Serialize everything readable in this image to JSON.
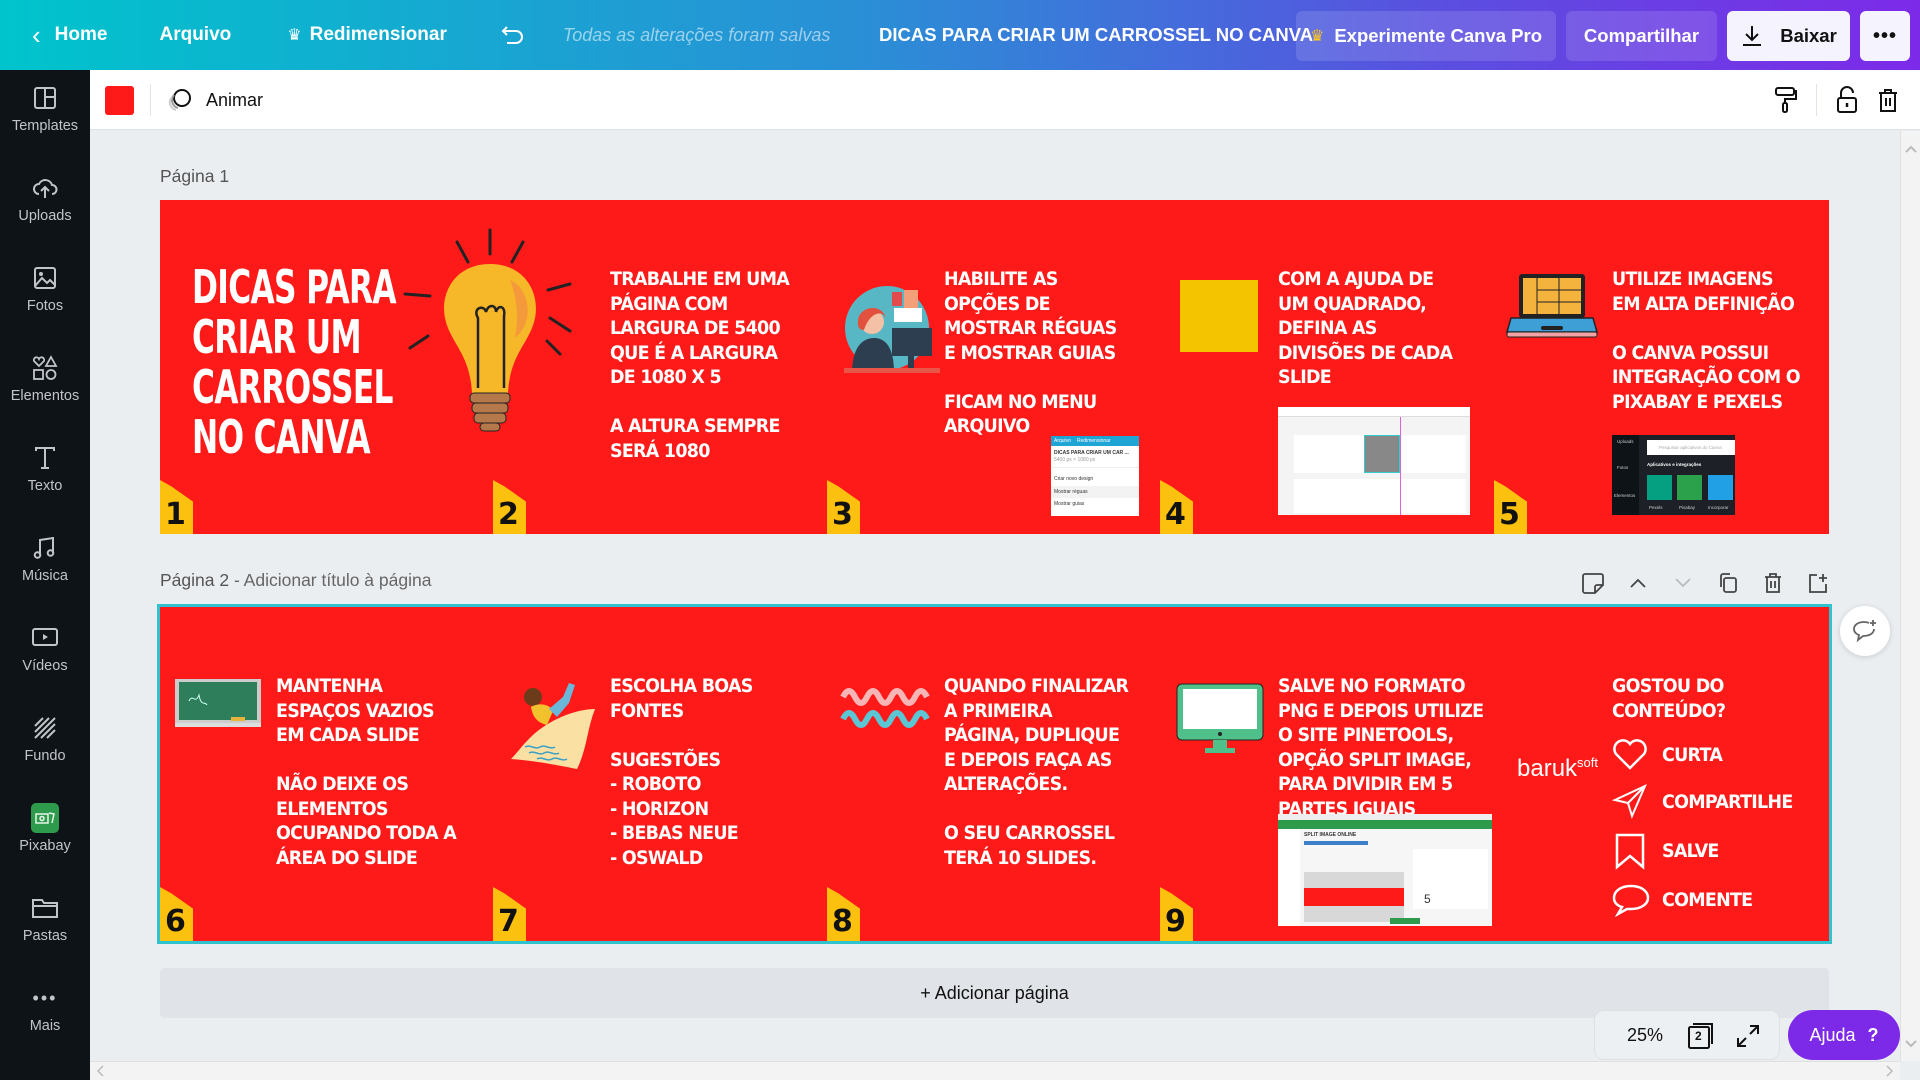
{
  "topbar": {
    "home_label": "Home",
    "file_label": "Arquivo",
    "resize_label": "Redimensionar",
    "saved_status": "Todas as alterações foram salvas",
    "design_title": "DICAS PARA CRIAR UM CARROSSEL NO CANVA",
    "pro_label": "Experimente Canva Pro",
    "share_label": "Compartilhar",
    "download_label": "Baixar",
    "more_label": "•••"
  },
  "sidebar": {
    "items": [
      {
        "label": "Templates",
        "icon": "templates-icon"
      },
      {
        "label": "Uploads",
        "icon": "upload-cloud-icon"
      },
      {
        "label": "Fotos",
        "icon": "photo-icon"
      },
      {
        "label": "Elementos",
        "icon": "elements-icon"
      },
      {
        "label": "Texto",
        "icon": "text-icon"
      },
      {
        "label": "Música",
        "icon": "music-icon"
      },
      {
        "label": "Vídeos",
        "icon": "video-icon"
      },
      {
        "label": "Fundo",
        "icon": "background-icon"
      },
      {
        "label": "Pixabay",
        "icon": "pixabay-icon"
      },
      {
        "label": "Pastas",
        "icon": "folder-icon"
      },
      {
        "label": "Mais",
        "icon": "more-icon"
      }
    ]
  },
  "toolbar": {
    "color": "#ff1a1a",
    "animate_label": "Animar"
  },
  "pages": [
    {
      "label": "Página 1",
      "title_hint": "",
      "title": "DICAS PARA\nCRIAR UM\nCARROSSEL\nNO CANVA",
      "slides": [
        {
          "number": "1"
        },
        {
          "number": "2",
          "text": "TRABALHE EM UMA\nPÁGINA COM\nLARGURA DE 5400\nQUE É A LARGURA\nDE 1080 X 5\n\nA ALTURA SEMPRE\nSERÁ 1080"
        },
        {
          "number": "3",
          "text": "HABILITE AS\nOPÇÕES DE\nMOSTRAR RÉGUAS\nE MOSTRAR GUIAS\n\nFICAM NO MENU\nARQUIVO"
        },
        {
          "number": "4",
          "text": "COM A AJUDA DE\nUM QUADRADO,\nDEFINA AS\nDIVISÕES DE CADA\nSLIDE"
        },
        {
          "number": "5",
          "text": "UTILIZE IMAGENS\nEM ALTA DEFINIÇÃO\n\nO CANVA POSSUI\nINTEGRAÇÃO COM O\nPIXABAY E PEXELS"
        }
      ],
      "menu_screenshot": {
        "tab1": "Arquivo",
        "tab2": "Redimensionar",
        "title": "DICAS PARA CRIAR UM CAR ...",
        "size": "5400 px × 1080 px",
        "item1": "Criar novo design",
        "item2": "Mostrar réguas",
        "item3": "Mostrar guias"
      },
      "apps_screenshot": {
        "search_placeholder": "Pesquisar aplicativos do Canva",
        "heading": "Aplicativos e integrações",
        "apps": [
          "Pexels",
          "Pixabay",
          "Incorporar"
        ],
        "side": [
          "Uploads",
          "Fotos",
          "Elementos"
        ]
      }
    },
    {
      "label": "Página 2",
      "title_hint": " - Adicionar título à página",
      "slides": [
        {
          "number": "6",
          "text": "MANTENHA\nESPAÇOS VAZIOS\nEM CADA SLIDE\n\nNÃO DEIXE OS\nELEMENTOS\nOCUPANDO TODA A\nÁREA DO SLIDE"
        },
        {
          "number": "7",
          "text": "ESCOLHA BOAS\nFONTES\n\nSUGESTÕES\n- ROBOTO\n- HORIZON\n- BEBAS NEUE\n- OSWALD"
        },
        {
          "number": "8",
          "text": "QUANDO FINALIZAR\nA PRIMEIRA\nPÁGINA, DUPLIQUE\nE DEPOIS FAÇA AS\nALTERAÇÕES.\n\nO SEU CARROSSEL\nTERÁ 10 SLIDES."
        },
        {
          "number": "9",
          "text": "SALVE  NO FORMATO\nPNG E DEPOIS UTILIZE\nO SITE PINETOOLS,\nOPÇÃO SPLIT IMAGE,\nPARA DIVIDIR EM 5\nPARTES IGUAIS"
        },
        {
          "number": "",
          "text": "GOSTOU DO\nCONTEÚDO?"
        }
      ],
      "brand": {
        "main": "baruk",
        "suffix": "soft"
      },
      "cta": [
        {
          "label": "CURTA",
          "icon": "heart-icon"
        },
        {
          "label": "COMPARTILHE",
          "icon": "send-icon"
        },
        {
          "label": "SALVE",
          "icon": "bookmark-icon"
        },
        {
          "label": "COMENTE",
          "icon": "comment-icon"
        }
      ],
      "split_screenshot": {
        "title": "SPLIT IMAGE ONLINE",
        "digit": "5"
      }
    }
  ],
  "add_page_label": "+ Adicionar página",
  "zoom": {
    "level": "25%",
    "page_count": "2"
  },
  "help_label": "Ajuda",
  "help_icon": "?"
}
